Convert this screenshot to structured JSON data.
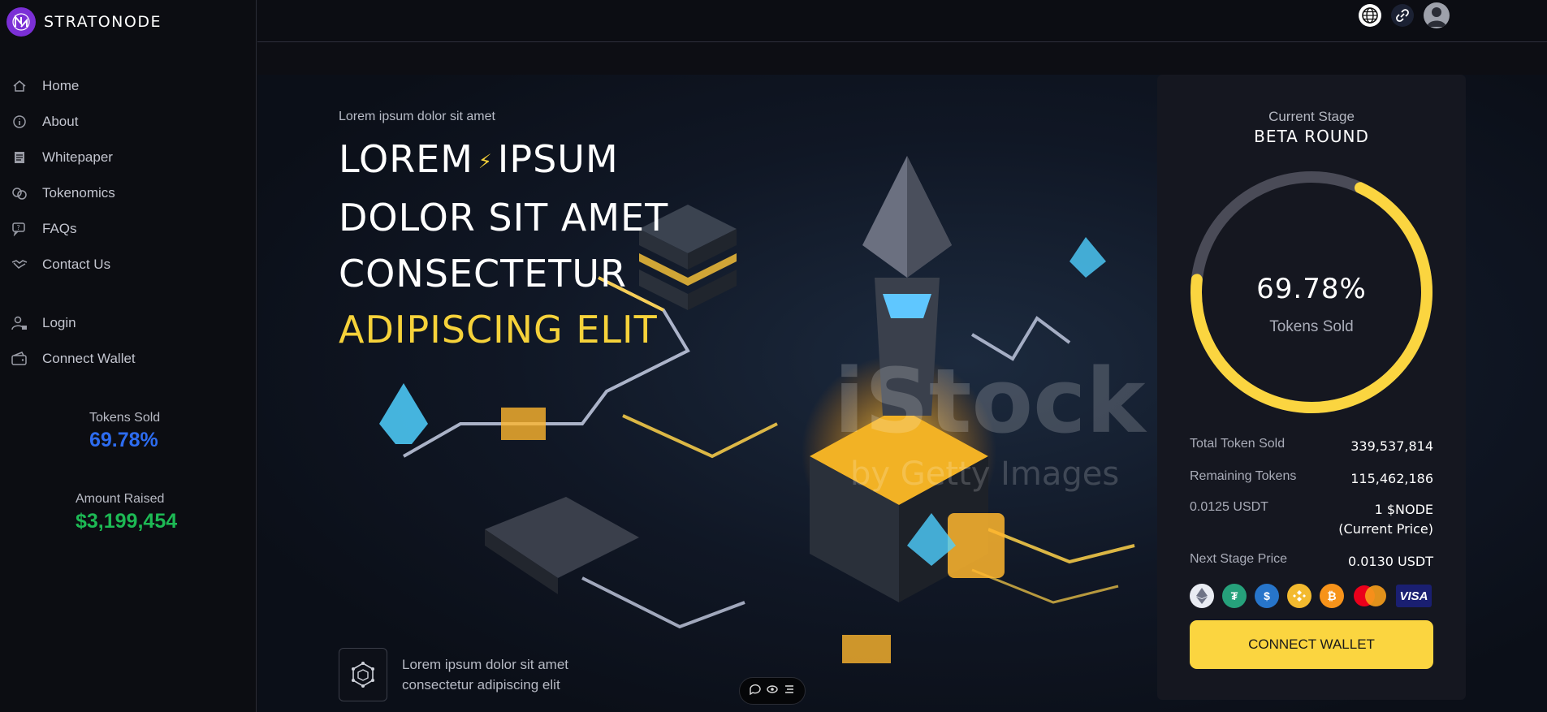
{
  "brand": {
    "name": "STRATONODE"
  },
  "sidebar": {
    "nav": [
      {
        "label": "Home",
        "icon": "home-icon"
      },
      {
        "label": "About",
        "icon": "info-icon"
      },
      {
        "label": "Whitepaper",
        "icon": "document-icon"
      },
      {
        "label": "Tokenomics",
        "icon": "coins-icon"
      },
      {
        "label": "FAQs",
        "icon": "question-chat-icon"
      },
      {
        "label": "Contact Us",
        "icon": "handshake-icon"
      }
    ],
    "account": [
      {
        "label": "Login",
        "icon": "user-lock-icon"
      },
      {
        "label": "Connect Wallet",
        "icon": "wallet-icon"
      }
    ],
    "stats": {
      "tokens_sold_label": "Tokens Sold",
      "tokens_sold_value": "69.78%",
      "amount_raised_label": "Amount Raised",
      "amount_raised_value": "$3,199,454"
    }
  },
  "topbar": {
    "icons": [
      "globe-icon",
      "link-icon",
      "avatar"
    ]
  },
  "hero": {
    "kicker": "Lorem ipsum dolor sit amet",
    "title_line1a": "LOREM",
    "title_line1b": "IPSUM",
    "title_line2": "DOLOR SIT AMET",
    "title_line3": "CONSECTETUR",
    "title_line4": "ADIPISCING ELIT",
    "feature_line1": "Lorem ipsum dolor sit amet",
    "feature_line2": "consectetur adipiscing elit",
    "watermark": "iStock",
    "watermark_sub": "by Getty Images"
  },
  "panel": {
    "stage_label": "Current Stage",
    "stage_name": "BETA ROUND",
    "progress_percent": 69.78,
    "progress_label": "69.78%",
    "progress_caption": "Tokens Sold",
    "rows": [
      {
        "key": "Total Token Sold",
        "value": "339,537,814"
      },
      {
        "key": "Remaining Tokens",
        "value": "115,462,186"
      },
      {
        "key": "0.0125 USDT",
        "value": "1 $NODE",
        "value2": "(Current Price)"
      },
      {
        "key": "Next Stage Price",
        "value": "0.0130 USDT"
      }
    ],
    "payments": [
      "ethereum-icon",
      "tether-icon",
      "usdc-icon",
      "bnb-icon",
      "bitcoin-icon",
      "mastercard-icon",
      "visa-icon"
    ],
    "visa_label": "VISA",
    "connect_label": "CONNECT WALLET"
  },
  "colors": {
    "accent_yellow": "#fbd540",
    "brand_purple": "#7b2fd6",
    "stat_blue": "#2d6cf0",
    "stat_green": "#1db954"
  }
}
